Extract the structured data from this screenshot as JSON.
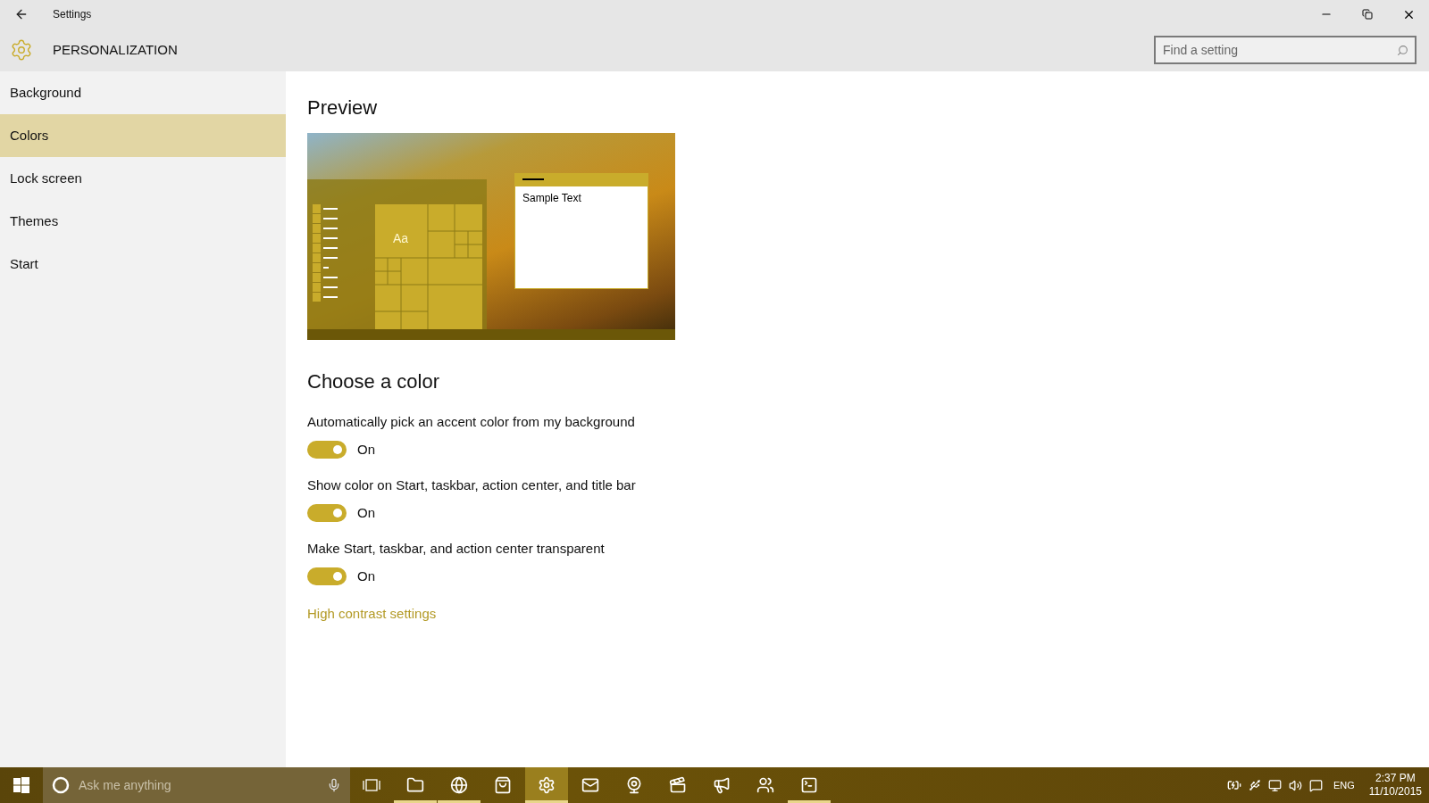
{
  "window": {
    "title": "Settings"
  },
  "header": {
    "title": "PERSONALIZATION"
  },
  "search": {
    "placeholder": "Find a setting"
  },
  "sidebar": {
    "items": [
      {
        "label": "Background",
        "selected": false
      },
      {
        "label": "Colors",
        "selected": true
      },
      {
        "label": "Lock screen",
        "selected": false
      },
      {
        "label": "Themes",
        "selected": false
      },
      {
        "label": "Start",
        "selected": false
      }
    ]
  },
  "preview": {
    "title": "Preview",
    "tile_text": "Aa",
    "window_text": "Sample Text"
  },
  "color_section": {
    "title": "Choose a color",
    "toggles": [
      {
        "label": "Automatically pick an accent color from my background",
        "on": true,
        "state_text": "On"
      },
      {
        "label": "Show color on Start, taskbar, action center, and title bar",
        "on": true,
        "state_text": "On"
      },
      {
        "label": "Make Start, taskbar, and action center transparent",
        "on": true,
        "state_text": "On"
      }
    ],
    "link": "High contrast settings"
  },
  "taskbar": {
    "search_placeholder": "Ask me anything",
    "apps": [
      {
        "kind": "explorer",
        "running": true,
        "selected": false
      },
      {
        "kind": "browser",
        "running": true,
        "selected": false
      },
      {
        "kind": "store",
        "running": false,
        "selected": false
      },
      {
        "kind": "settings",
        "running": true,
        "selected": true
      },
      {
        "kind": "mail",
        "running": false,
        "selected": false
      },
      {
        "kind": "webcam",
        "running": false,
        "selected": false
      },
      {
        "kind": "movies",
        "running": false,
        "selected": false
      },
      {
        "kind": "megaphone",
        "running": false,
        "selected": false
      },
      {
        "kind": "people",
        "running": false,
        "selected": false
      },
      {
        "kind": "terminal",
        "running": true,
        "selected": false
      }
    ],
    "language": "ENG",
    "time": "2:37 PM",
    "date": "11/10/2015"
  }
}
